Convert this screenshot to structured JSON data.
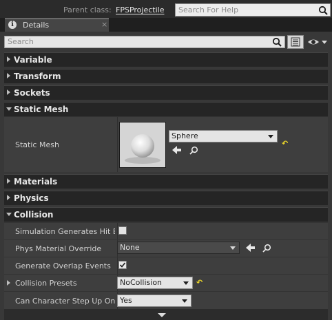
{
  "header": {
    "parent_label": "Parent class:",
    "parent_value": "FPSProjectile",
    "help_search_placeholder": "Search For Help"
  },
  "tab": {
    "label": "Details",
    "close": "×",
    "icon": "info-icon"
  },
  "search": {
    "placeholder": "Search"
  },
  "categories": {
    "variable": "Variable",
    "transform": "Transform",
    "sockets": "Sockets",
    "static_mesh": "Static Mesh",
    "materials": "Materials",
    "physics": "Physics",
    "collision": "Collision"
  },
  "static_mesh": {
    "label": "Static Mesh",
    "value": "Sphere",
    "reset": "↶"
  },
  "collision": {
    "sim_hit_label": "Simulation Generates Hit Events",
    "sim_hit_checked": false,
    "phys_material_label": "Phys Material Override",
    "phys_material_value": "None",
    "overlap_label": "Generate Overlap Events",
    "overlap_checked": true,
    "presets_label": "Collision Presets",
    "presets_value": "NoCollision",
    "presets_reset": "↶",
    "step_up_label": "Can Character Step Up On",
    "step_up_value": "Yes"
  },
  "colors": {
    "reset_accent": "#e6d12a",
    "panel_bg": "#383838",
    "category_bg": "#252525"
  }
}
